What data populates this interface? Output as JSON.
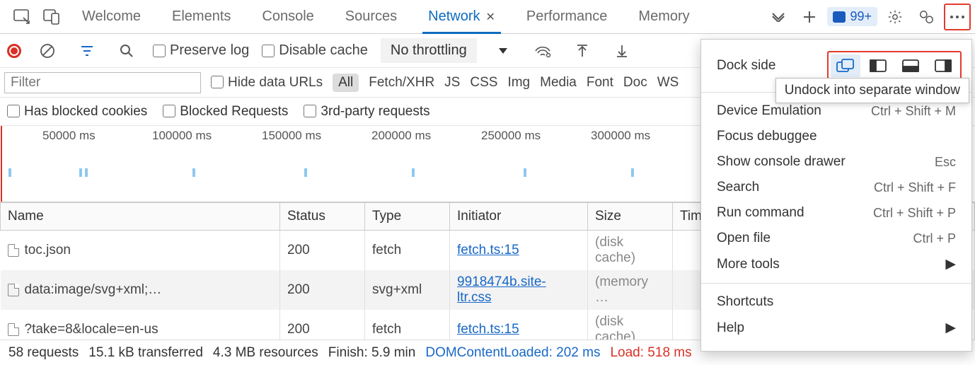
{
  "tabs": {
    "welcome": "Welcome",
    "elements": "Elements",
    "console": "Console",
    "sources": "Sources",
    "network": "Network",
    "performance": "Performance",
    "memory": "Memory"
  },
  "badge_count": "99+",
  "toolbar": {
    "preserve_log": "Preserve log",
    "disable_cache": "Disable cache",
    "no_throttling": "No throttling"
  },
  "filter": {
    "placeholder": "Filter",
    "hide_data_urls": "Hide data URLs",
    "all": "All",
    "fetch": "Fetch/XHR",
    "js": "JS",
    "css": "CSS",
    "img": "Img",
    "media": "Media",
    "font": "Font",
    "doc": "Doc",
    "ws": "WS"
  },
  "checks": {
    "has_blocked": "Has blocked cookies",
    "blocked_req": "Blocked Requests",
    "third_party": "3rd-party requests"
  },
  "timeline_ticks": [
    "50000 ms",
    "100000 ms",
    "150000 ms",
    "200000 ms",
    "250000 ms",
    "300000 ms"
  ],
  "columns": {
    "name": "Name",
    "status": "Status",
    "type": "Type",
    "initiator": "Initiator",
    "size": "Size",
    "time": "Time"
  },
  "rows": [
    {
      "name": "toc.json",
      "status": "200",
      "type": "fetch",
      "initiator": "fetch.ts:15",
      "size": "(disk cache)"
    },
    {
      "name": "data:image/svg+xml;…",
      "status": "200",
      "type": "svg+xml",
      "initiator": "9918474b.site-ltr.css",
      "size": "(memory …"
    },
    {
      "name": "?take=8&locale=en-us",
      "status": "200",
      "type": "fetch",
      "initiator": "fetch.ts:15",
      "size": "(disk cache)"
    }
  ],
  "status": {
    "requests": "58 requests",
    "transferred": "15.1 kB transferred",
    "resources": "4.3 MB resources",
    "finish": "Finish: 5.9 min",
    "dom": "DOMContentLoaded: 202 ms",
    "load": "Load: 518 ms"
  },
  "menu": {
    "dock_side": "Dock side",
    "tooltip": "Undock into separate window",
    "device": "Device Emulation",
    "device_sc": "Ctrl + Shift + M",
    "focus": "Focus debuggee",
    "drawer": "Show console drawer",
    "drawer_sc": "Esc",
    "search": "Search",
    "search_sc": "Ctrl + Shift + F",
    "run": "Run command",
    "run_sc": "Ctrl + Shift + P",
    "open": "Open file",
    "open_sc": "Ctrl + P",
    "more_tools": "More tools",
    "shortcuts": "Shortcuts",
    "help": "Help"
  }
}
